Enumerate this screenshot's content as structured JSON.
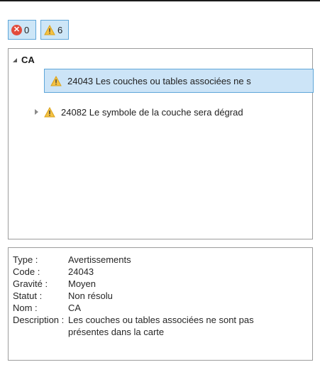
{
  "filters": {
    "errors": {
      "count": "0",
      "icon": "error-icon"
    },
    "warnings": {
      "count": "6",
      "icon": "warning-icon"
    }
  },
  "tree": {
    "root_label": "CA",
    "items": [
      {
        "code": "24043",
        "text": "24043 Les couches ou tables associées ne s",
        "selected": true,
        "icon": "warning-icon"
      },
      {
        "code": "24082",
        "text": "24082 Le symbole de la couche sera dégrad",
        "selected": false,
        "icon": "warning-icon",
        "expandable": true
      }
    ]
  },
  "details": {
    "type_label": "Type :",
    "type_value": "Avertissements",
    "code_label": "Code :",
    "code_value": "24043",
    "severity_label": "Gravité :",
    "severity_value": "Moyen",
    "status_label": "Statut :",
    "status_value": "Non résolu",
    "name_label": "Nom :",
    "name_value": "CA",
    "description_label": "Description :",
    "description_value": "Les couches ou tables associées ne sont pas présentes dans la carte"
  },
  "colors": {
    "selection_bg": "#cce4f7",
    "selection_border": "#5ea6d9",
    "error_red": "#e24b3b",
    "warning_yellow": "#f5c242"
  }
}
